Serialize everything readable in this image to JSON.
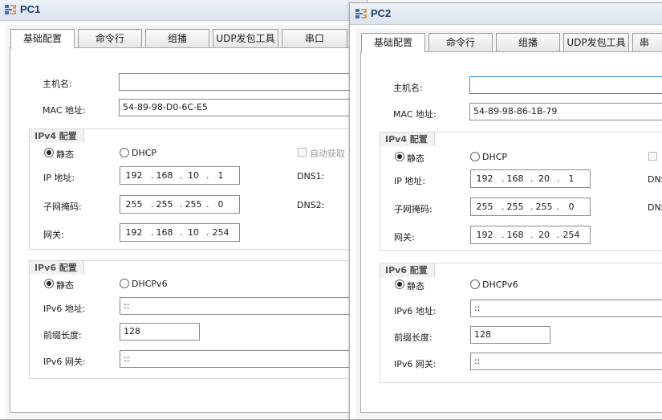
{
  "pc1": {
    "title": "PC1",
    "tabs": [
      "基础配置",
      "命令行",
      "组播",
      "UDP发包工具",
      "串口"
    ],
    "hostname_label": "主机名:",
    "hostname_value": "",
    "mac_label": "MAC 地址:",
    "mac_value": "54-89-98-D0-6C-E5",
    "ipv4": {
      "title": "IPv4 配置",
      "static_label": "静态",
      "dhcp_label": "DHCP",
      "auto_dns_label": "自动获取",
      "ip_label": "IP 地址:",
      "ip": [
        "192",
        "168",
        "10",
        "1"
      ],
      "mask_label": "子网掩码:",
      "mask": [
        "255",
        "255",
        "255",
        "0"
      ],
      "gw_label": "网关:",
      "gw": [
        "192",
        "168",
        "10",
        "254"
      ],
      "dns1_label": "DNS1:",
      "dns2_label": "DNS2:"
    },
    "ipv6": {
      "title": "IPv6 配置",
      "static_label": "静态",
      "dhcp_label": "DHCPv6",
      "addr_label": "IPv6 地址:",
      "addr_value": "::",
      "prefix_label": "前缀长度:",
      "prefix_value": "128",
      "gw_label": "IPv6 网关:",
      "gw_value": "::"
    }
  },
  "pc2": {
    "title": "PC2",
    "tabs": [
      "基础配置",
      "命令行",
      "组播",
      "UDP发包工具",
      "串"
    ],
    "hostname_label": "主机名:",
    "hostname_value": "",
    "mac_label": "MAC 地址:",
    "mac_value": "54-89-98-86-1B-79",
    "ipv4": {
      "title": "IPv4 配置",
      "static_label": "静态",
      "dhcp_label": "DHCP",
      "ip_label": "IP 地址:",
      "ip": [
        "192",
        "168",
        "20",
        "1"
      ],
      "mask_label": "子网掩码:",
      "mask": [
        "255",
        "255",
        "255",
        "0"
      ],
      "gw_label": "网关:",
      "gw": [
        "192",
        "168",
        "20",
        "254"
      ],
      "dns1_label": "DNS",
      "dns2_label": "DNS"
    },
    "ipv6": {
      "title": "IPv6 配置",
      "static_label": "静态",
      "dhcp_label": "DHCPv6",
      "addr_label": "IPv6 地址:",
      "addr_value": "::",
      "prefix_label": "前缀长度:",
      "prefix_value": "128",
      "gw_label": "IPv6 网关:",
      "gw_value": "::"
    }
  },
  "colors": {
    "title_text": "#1b3d73",
    "focus_border": "#3c8de0"
  },
  "icons": {
    "window": "pc-window-icon"
  }
}
